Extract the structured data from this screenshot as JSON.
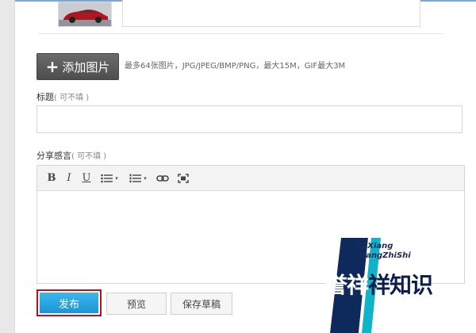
{
  "media": {
    "add_image_label": "添加图片",
    "add_image_plus": "+",
    "hint": "最多64张图片，JPG/JPEG/BMP/PNG，最大15M，GIF最大3M"
  },
  "title_field": {
    "label": "标题",
    "optional": "( 可不填 )",
    "value": ""
  },
  "share_field": {
    "label": "分享感言",
    "optional": "( 可不填 )"
  },
  "toolbar": {
    "bold": "B",
    "italic": "I",
    "underline": "U",
    "caret": "▾"
  },
  "actions": {
    "publish": "发布",
    "preview": "预览",
    "save_draft": "保存草稿"
  },
  "watermark": {
    "line1": "YuXiang",
    "line2": "XiangZhiShi",
    "cn_lead": "誉祥",
    "cn_rest": "祥知识"
  },
  "colors": {
    "publish_button": "#1c95d6",
    "highlight_border": "#b5121b",
    "add_button": "#555555"
  }
}
